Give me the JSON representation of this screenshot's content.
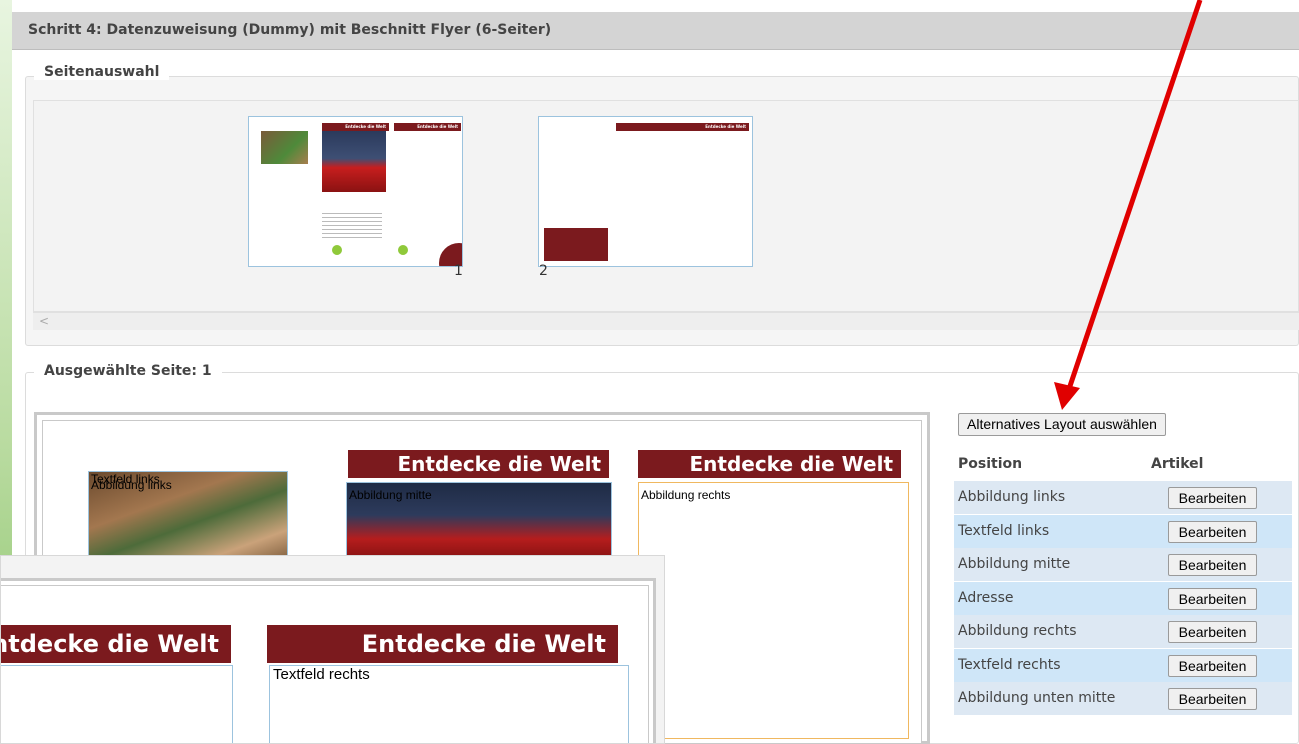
{
  "step": {
    "title": "Schritt 4:  Datenzuweisung (Dummy) mit Beschnitt Flyer (6-Seiter)"
  },
  "page_selection": {
    "legend": "Seitenauswahl",
    "pages": [
      {
        "number": "1",
        "banner": "Entdecke die Welt"
      },
      {
        "number": "2",
        "banner": "Entdecke die Welt"
      }
    ],
    "scroll_left": "<"
  },
  "selected_page": {
    "legend": "Ausgewählte Seite: 1",
    "banners": [
      "Entdecke die Welt",
      "Entdecke die Welt"
    ],
    "fields": {
      "textfeld_links": "Textfeld links",
      "abbildung_links": "Abbildung links",
      "abbildung_mitte": "Abbildung mitte",
      "abbildung_rechts": "Abbildung rechts"
    }
  },
  "layout_panel": {
    "alt_button": "Alternatives Layout auswählen",
    "col_position": "Position",
    "col_artikel": "Artikel",
    "rows": [
      {
        "position": "Abbildung links",
        "action": "Bearbeiten"
      },
      {
        "position": "Textfeld links",
        "action": "Bearbeiten"
      },
      {
        "position": "Abbildung mitte",
        "action": "Bearbeiten"
      },
      {
        "position": "Adresse",
        "action": "Bearbeiten"
      },
      {
        "position": "Abbildung rechts",
        "action": "Bearbeiten"
      },
      {
        "position": "Textfeld rechts",
        "action": "Bearbeiten"
      },
      {
        "position": "Abbildung unten mitte",
        "action": "Bearbeiten"
      }
    ],
    "row_colors": [
      "#dde8f3",
      "#cfe6f8"
    ]
  },
  "zoom_overlay": {
    "banners": [
      "ntdecke die Welt",
      "Entdecke die Welt"
    ],
    "field_label": "Textfeld rechts"
  },
  "colors": {
    "banner": "#7b1a1e",
    "arrow": "#e00000",
    "header_bg": "#d4d4d4"
  }
}
